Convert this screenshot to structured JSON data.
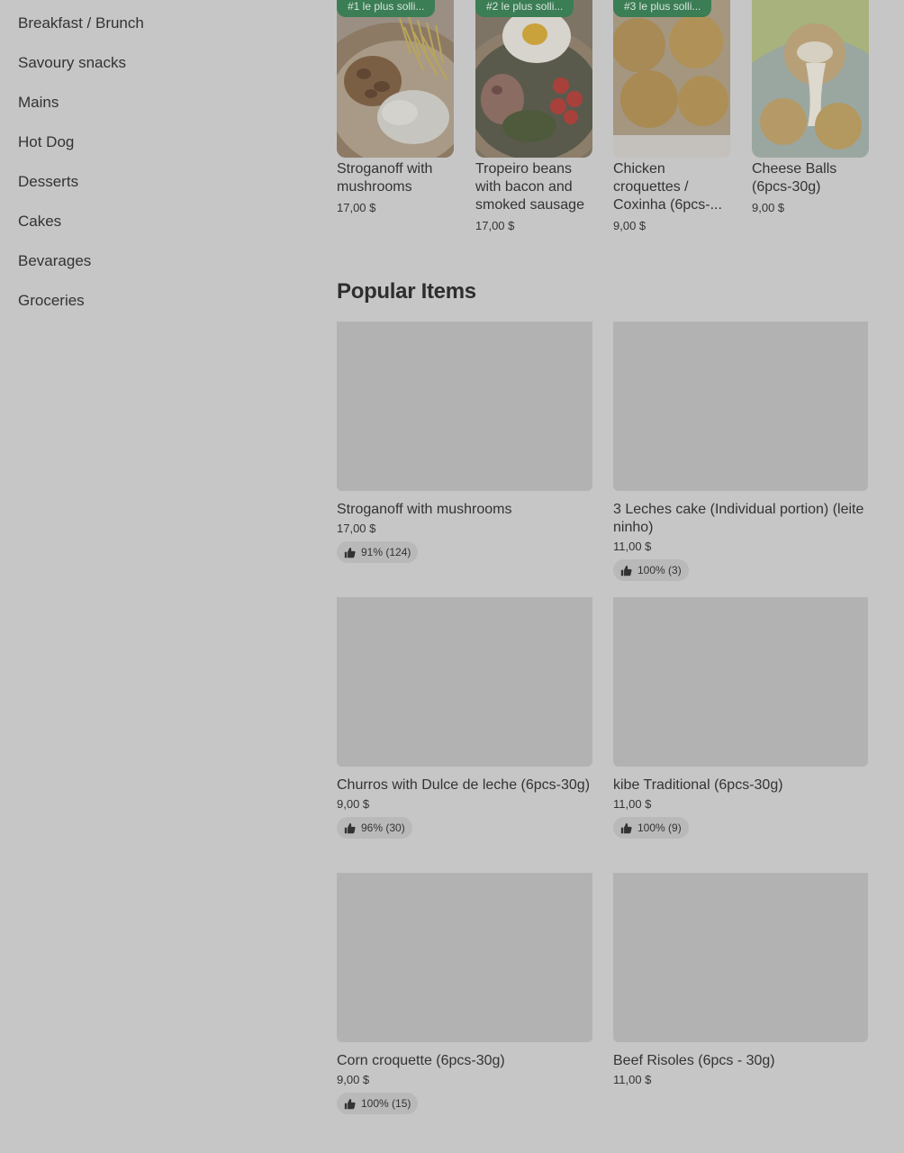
{
  "sidebar": {
    "items": [
      {
        "label": "Breakfast / Brunch"
      },
      {
        "label": "Savoury snacks"
      },
      {
        "label": "Mains"
      },
      {
        "label": "Hot Dog"
      },
      {
        "label": "Desserts"
      },
      {
        "label": "Cakes"
      },
      {
        "label": "Bevarages"
      },
      {
        "label": "Groceries"
      }
    ]
  },
  "carousel": [
    {
      "badge": "#1 le plus solli...",
      "name": "Stroganoff with mushrooms",
      "price": "17,00 $"
    },
    {
      "badge": "#2 le plus solli...",
      "name": "Tropeiro beans with bacon and smoked sausage",
      "price": "17,00 $"
    },
    {
      "badge": "#3 le plus solli...",
      "name": "Chicken croquettes / Coxinha (6pcs-...",
      "price": "9,00 $"
    },
    {
      "badge": "",
      "name": "Cheese Balls (6pcs-30g)",
      "price": "9,00 $"
    }
  ],
  "popular": {
    "title": "Popular Items",
    "items": [
      {
        "name": "Stroganoff with mushrooms",
        "price": "17,00 $",
        "rating": "91% (124)"
      },
      {
        "name": "3 Leches cake (Individual portion) (leite ninho)",
        "price": "11,00 $",
        "rating": "100% (3)"
      },
      {
        "name": "Churros with Dulce de leche (6pcs-30g)",
        "price": "9,00 $",
        "rating": "96% (30)"
      },
      {
        "name": "kibe Traditional (6pcs-30g)",
        "price": "11,00 $",
        "rating": "100% (9)"
      },
      {
        "name": "Corn croquette (6pcs-30g)",
        "price": "9,00 $",
        "rating": "100% (15)"
      },
      {
        "name": "Beef Risoles (6pcs - 30g)",
        "price": "11,00 $",
        "rating": ""
      }
    ]
  },
  "icons": {
    "rating": "thumbs-up-icon"
  },
  "colors": {
    "badge": "#3b7d55",
    "overlay": "#c6c6c6"
  }
}
